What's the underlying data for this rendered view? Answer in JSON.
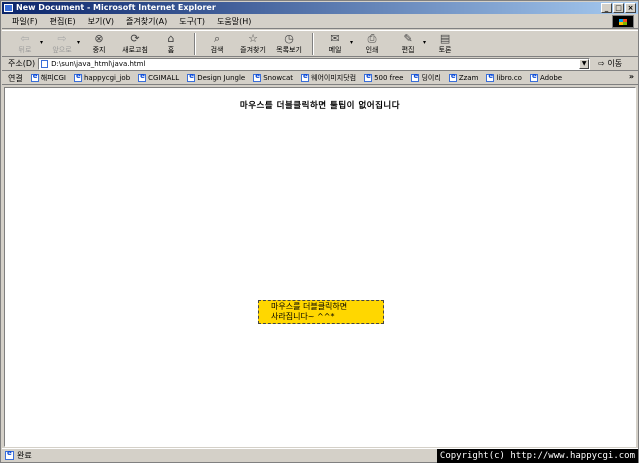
{
  "window": {
    "title": "New Document - Microsoft Internet Explorer",
    "buttons": [
      "_",
      "□",
      "×"
    ]
  },
  "menu": [
    "파일(F)",
    "편집(E)",
    "보기(V)",
    "즐겨찾기(A)",
    "도구(T)",
    "도움말(H)"
  ],
  "toolbar": {
    "back": {
      "label": "뒤로",
      "icon": "back-arrow-icon"
    },
    "forward": {
      "label": "앞으로",
      "icon": "forward-arrow-icon"
    },
    "stop": {
      "label": "중지",
      "icon": "stop-icon"
    },
    "refresh": {
      "label": "새로고침",
      "icon": "refresh-icon"
    },
    "home": {
      "label": "홈",
      "icon": "home-icon"
    },
    "search": {
      "label": "검색",
      "icon": "search-icon"
    },
    "favorites": {
      "label": "즐겨찾기",
      "icon": "favorites-icon"
    },
    "history": {
      "label": "목록보기",
      "icon": "history-icon"
    },
    "mail": {
      "label": "메일",
      "icon": "mail-icon"
    },
    "print": {
      "label": "인쇄",
      "icon": "print-icon"
    },
    "edit": {
      "label": "편집",
      "icon": "edit-icon"
    },
    "discuss": {
      "label": "토론",
      "icon": "discuss-icon"
    }
  },
  "address": {
    "label": "주소(D)",
    "value": "D:\\sun\\java_html\\java.html",
    "go_label": "이동"
  },
  "links": {
    "label": "연결",
    "items": [
      "해피CGI",
      "happycgi_job",
      "CGIMALL",
      "Design Jungle",
      "Snowcat",
      "웨어이미지닷컴",
      "500 free",
      "딩이리",
      "Zzam",
      "libro.co",
      "Adobe"
    ],
    "more": "»"
  },
  "page": {
    "heading": "마우스를 더블클릭하면 툴팁이 없어집니다",
    "tooltip_line1": "마우스를 더블클릭하면",
    "tooltip_line2": "사라집니다~ ^^*"
  },
  "status": {
    "text": "완료",
    "copyright": "Copyright(c) http://www.happycgi.com"
  }
}
